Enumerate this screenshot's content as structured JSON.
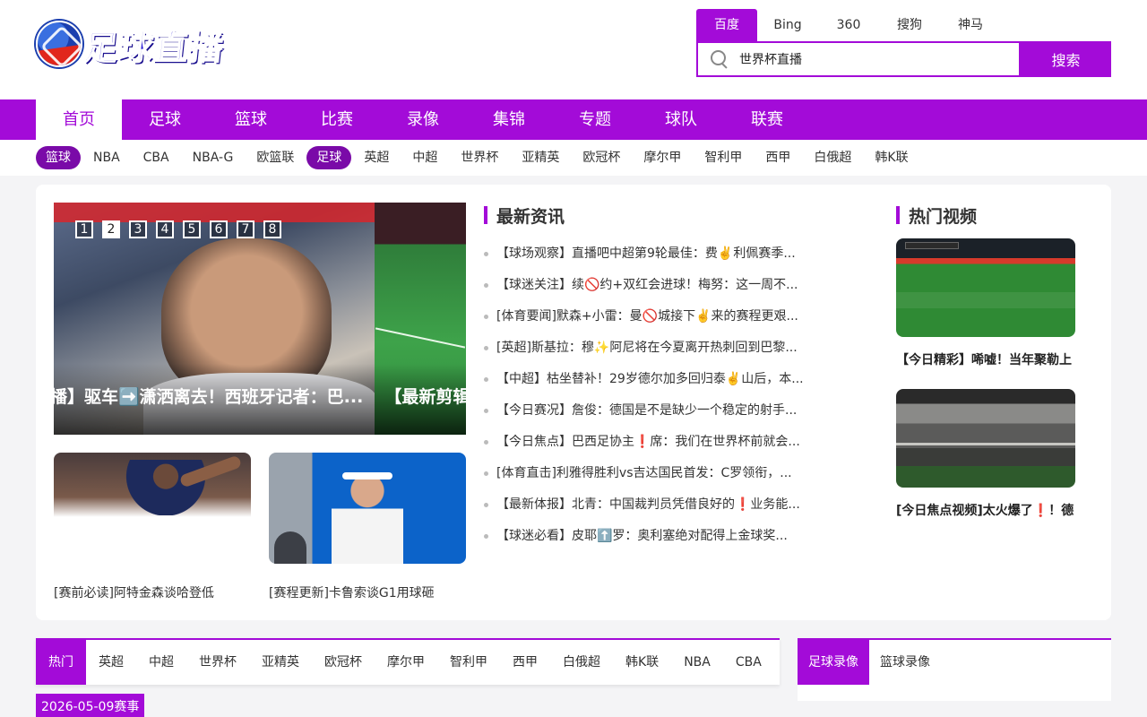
{
  "logo": {
    "text": "足球直播"
  },
  "search": {
    "engines": [
      "百度",
      "Bing",
      "360",
      "搜狗",
      "神马"
    ],
    "value": "世界杯直播",
    "button": "搜索"
  },
  "main_nav": [
    "首页",
    "足球",
    "篮球",
    "比赛",
    "录像",
    "集锦",
    "专题",
    "球队",
    "联赛"
  ],
  "sub_nav": [
    "篮球",
    "NBA",
    "CBA",
    "NBA-G",
    "欧篮联",
    "足球",
    "英超",
    "中超",
    "世界杯",
    "亚精英",
    "欧冠杯",
    "摩尔甲",
    "智利甲",
    "西甲",
    "白俄超",
    "韩K联"
  ],
  "slider": {
    "dots": [
      "1",
      "2",
      "3",
      "4",
      "5",
      "6",
      "7",
      "8"
    ],
    "caption_1": "播】驱车➡️潇洒离去！西班牙记者：巴...",
    "caption_2": "【最新剪辑"
  },
  "thumbs": [
    {
      "title": "[赛前必读]阿特金森谈哈登低"
    },
    {
      "title": "[赛程更新]卡鲁索谈G1用球砸"
    }
  ],
  "latest_news": {
    "title": "最新资讯",
    "items": [
      "【球场观察】直播吧中超第9轮最佳：费✌️利佩赛季...",
      "【球迷关注】续🚫约+双红会进球！梅努：这一周不...",
      "[体育要闻]默森+小雷：曼🚫城接下✌️来的赛程更艰...",
      "[英超]斯基拉：穆✨阿尼将在今夏离开热刺回到巴黎...",
      "【中超】枯坐替补！29岁德尔加多回归泰✌️山后，本...",
      "【今日赛况】詹俊：德国是不是缺少一个稳定的射手...",
      "【今日焦点】巴西足协主❗席：我们在世界杯前就会...",
      "[体育直击]利雅得胜利vs吉达国民首发：C罗领衔，...",
      "【最新体报】北青：中国裁判员凭借良好的❗业务能...",
      "【球迷必看】皮耶⬆️罗：奥利塞绝对配得上金球奖..."
    ]
  },
  "hot_videos": {
    "title": "热门视频",
    "items": [
      {
        "title": "【今日精彩】唏嘘！当年聚勒上"
      },
      {
        "title": "[今日焦点视频]太火爆了❗！德"
      }
    ]
  },
  "schedule": {
    "tabs": [
      "热门",
      "英超",
      "中超",
      "世界杯",
      "亚精英",
      "欧冠杯",
      "摩尔甲",
      "智利甲",
      "西甲",
      "白俄超",
      "韩K联",
      "NBA",
      "CBA"
    ],
    "date": "2026-05-09赛事"
  },
  "recordings": {
    "tabs": [
      "足球录像",
      "篮球录像"
    ]
  },
  "colors": {
    "accent": "#a30bd8",
    "pill": "#7a0aa8"
  }
}
